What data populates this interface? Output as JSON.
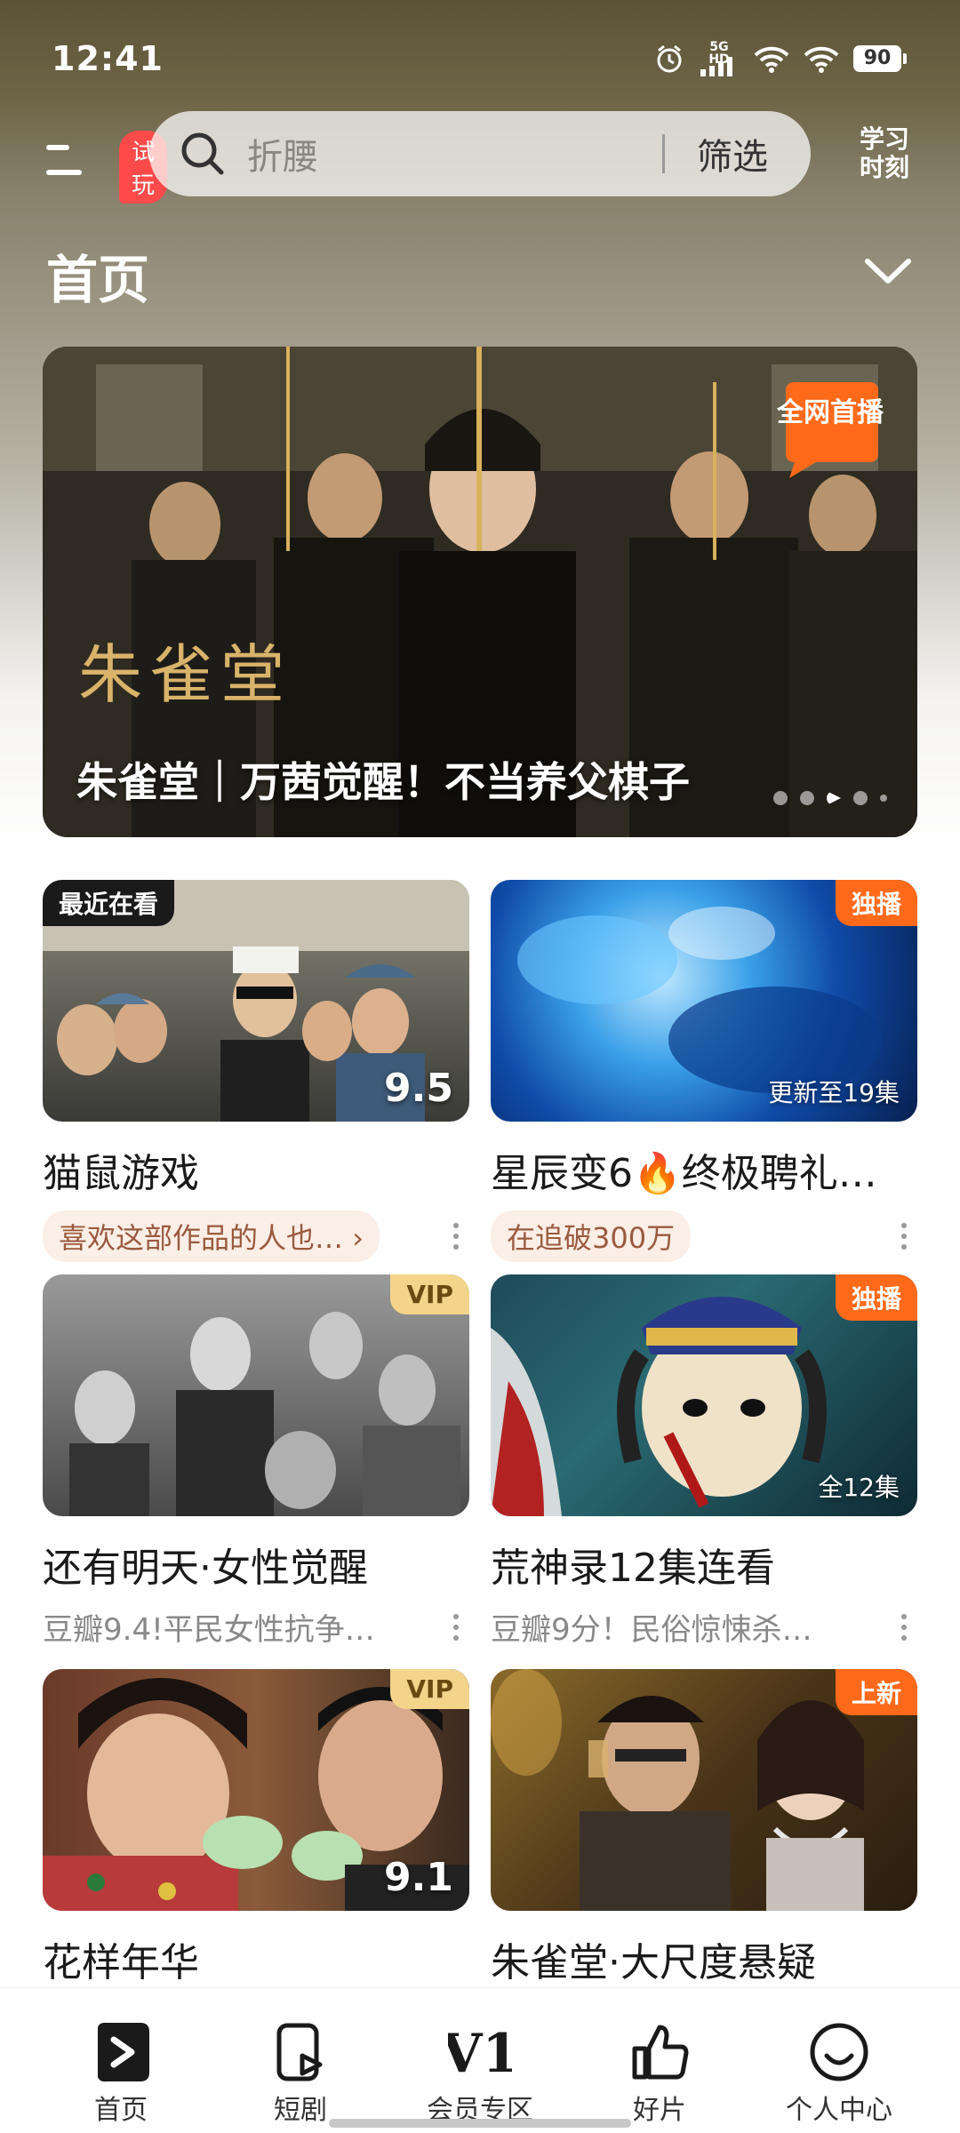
{
  "status_bar": {
    "time": "12:41",
    "network": "5G HD",
    "battery": "90",
    "icons": [
      "alarm-icon",
      "signal-icon",
      "wifi-icon",
      "wifi-icon",
      "battery-icon"
    ]
  },
  "header": {
    "menu_icon": "menu-icon",
    "trial_badge": "试玩",
    "search_placeholder": "折腰",
    "filter_label": "筛选",
    "learn_label": "学习时刻"
  },
  "page": {
    "title": "首页"
  },
  "banner": {
    "logo_text": "朱雀堂",
    "caption": "朱雀堂｜万茜觉醒！不当养父棋子",
    "badge": "全网首播",
    "dots": 5,
    "active_dot": 3
  },
  "cards": [
    {
      "title": "猫鼠游戏",
      "tag": "最近在看",
      "tag_side": "left",
      "score": "9.5",
      "episodes": "",
      "sub": "喜欢这部作品的人也…",
      "sub_style": "pill"
    },
    {
      "title": "星辰变6🔥终极聘礼…",
      "tag": "独播",
      "tag_side": "right",
      "score": "",
      "episodes": "更新至19集",
      "sub": "在追破300万",
      "sub_style": "pill"
    },
    {
      "title": "还有明天·女性觉醒",
      "tag": "VIP",
      "tag_side": "right",
      "score": "",
      "episodes": "",
      "sub": "豆瓣9.4!平民女性抗争…",
      "sub_style": "plain"
    },
    {
      "title": "荒神录12集连看",
      "tag": "独播",
      "tag_side": "right",
      "score": "",
      "episodes": "全12集",
      "sub": "豆瓣9分！民俗惊悚杀…",
      "sub_style": "plain"
    },
    {
      "title": "花样年华",
      "tag": "VIP",
      "tag_side": "right",
      "score": "9.1",
      "episodes": "",
      "sub": "",
      "sub_style": "plain"
    },
    {
      "title": "朱雀堂·大尺度悬疑",
      "tag": "上新",
      "tag_side": "right",
      "score": "",
      "episodes": "",
      "sub": "",
      "sub_style": "plain"
    }
  ],
  "tabbar": [
    {
      "label": "首页",
      "icon": "play-circle-icon",
      "active": true
    },
    {
      "label": "短剧",
      "icon": "short-video-icon",
      "active": false
    },
    {
      "label": "会员专区",
      "icon": "vip-v1-icon",
      "active": false
    },
    {
      "label": "好片",
      "icon": "thumbs-up-icon",
      "active": false
    },
    {
      "label": "个人中心",
      "icon": "smiley-icon",
      "active": false
    }
  ],
  "colors": {
    "accent": "#ff6a1a",
    "vip": "#f3d48a",
    "pill_bg": "#fbeee6",
    "trial": "#ff4a4a"
  }
}
